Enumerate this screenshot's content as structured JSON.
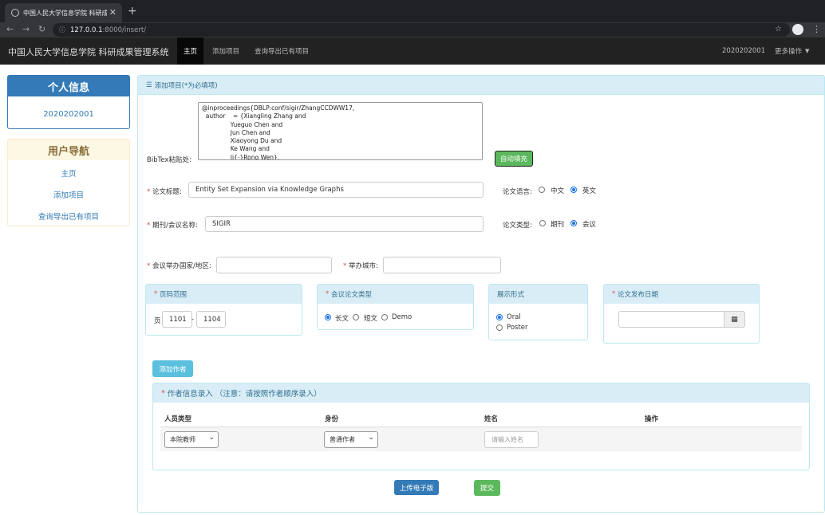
{
  "browser": {
    "tab_title": "中国人民大学信息学院 科研成果",
    "url_host": "127.0.0.1",
    "url_rest": ":8000/insert/"
  },
  "navbar": {
    "brand": "中国人民大学信息学院 科研成果管理系统",
    "items": [
      "主页",
      "添加项目",
      "查询导出已有项目"
    ],
    "user": "2020202001",
    "more": "更多操作"
  },
  "user_panel": {
    "title": "个人信息",
    "user_id": "2020202001"
  },
  "nav_panel": {
    "title": "用户导航",
    "links": [
      "主页",
      "添加项目",
      "查询导出已有项目"
    ]
  },
  "form": {
    "header": "添加项目(*为必填项)",
    "bibtex_label": "BibTex粘贴处:",
    "bibtex_value": "@inproceedings{DBLP:conf/sigir/ZhangCCDWW17,\n  author    = {Xiangling Zhang and\n               Yueguo Chen and\n               Jun Chen and\n               Xiaoyong Du and\n               Ke Wang and\n               Ji{-}Rong Wen},",
    "autofill_button": "自动填充",
    "title_label": "论文标题:",
    "title_value": "Entity Set Expansion via Knowledge Graphs",
    "language_label": "论文语言:",
    "language_options": [
      "中文",
      "英文"
    ],
    "venue_label": "期刊/会议名称:",
    "venue_value": "SIGIR",
    "type_label": "论文类型:",
    "type_options": [
      "期刊",
      "会议"
    ],
    "country_label": "会议举办国家/地区:",
    "city_label": "举办城市:",
    "pages_label": "页码范围",
    "pages_prefix": "页",
    "page_from": "1101",
    "page_to": "1104",
    "page_sep": "-",
    "conf_type_label": "会议论文类型",
    "conf_type_options": [
      "长文",
      "短文",
      "Demo"
    ],
    "display_label": "展示形式",
    "display_options": [
      "Oral",
      "Poster"
    ],
    "date_label": "论文发布日期",
    "add_author_button": "添加作者",
    "author_panel_title": "作者信息录入 （注意：请按照作者顺序录入）",
    "author_columns": [
      "人员类型",
      "身份",
      "姓名",
      "操作"
    ],
    "author_row": {
      "type": "本院教师",
      "role": "普通作者",
      "name_placeholder": "请输入姓名"
    },
    "upload_button": "上传电子版",
    "submit_button": "提交"
  },
  "colors": {
    "primary": "#337ab7",
    "success": "#5cb85c",
    "info": "#5bc0de",
    "navbar": "#222222"
  }
}
